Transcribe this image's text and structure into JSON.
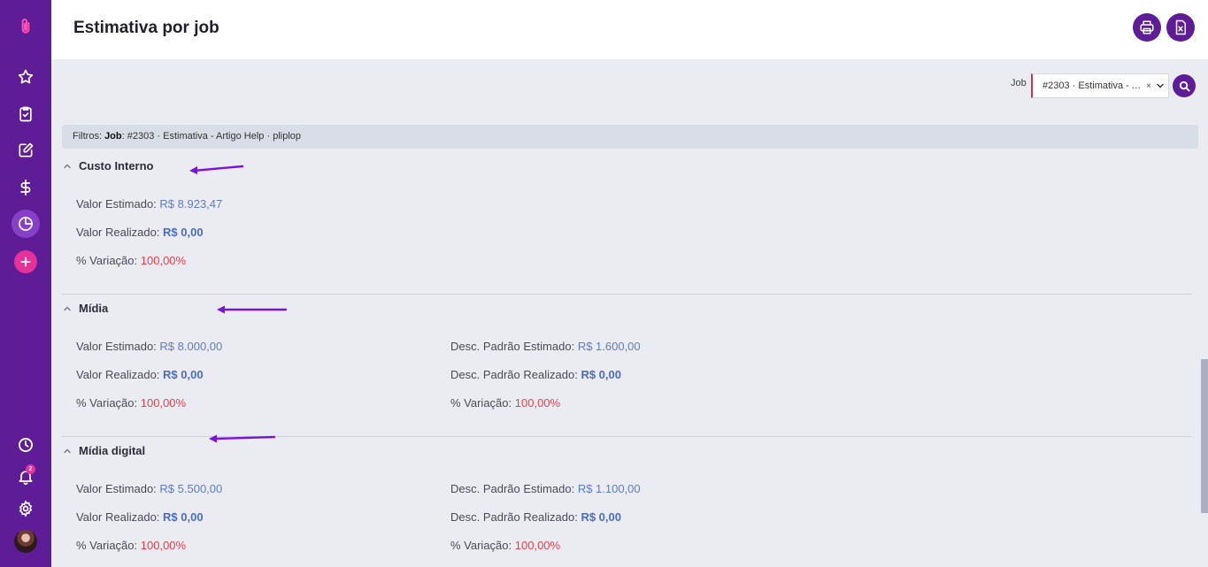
{
  "page_title": "Estimativa por job",
  "sidebar": {
    "icons": [
      "paperclip-logo-icon",
      "star-icon",
      "clipboard-check-icon",
      "edit-icon",
      "dollar-icon",
      "pie-chart-icon",
      "plus-icon",
      "clock-icon",
      "bell-icon",
      "gear-icon",
      "avatar"
    ],
    "notification_count": "2"
  },
  "filter": {
    "job_label": "Job",
    "job_value": "#2303 · Estimativa - Artigo Help · pliplop",
    "clear_symbol": "×"
  },
  "filters_bar": {
    "prefix": "Filtros:",
    "key": "Job",
    "value": ": #2303 · Estimativa - Artigo Help · pliplop"
  },
  "sections": [
    {
      "title": "Custo Interno",
      "left": [
        {
          "label": "Valor Estimado:",
          "value": "R$ 8.923,47"
        },
        {
          "label": "Valor Realizado:",
          "value": "R$ 0,00"
        },
        {
          "label": "% Variação:",
          "value": "100,00%"
        }
      ]
    },
    {
      "title": "Mídia",
      "left": [
        {
          "label": "Valor Estimado:",
          "value": "R$ 8.000,00"
        },
        {
          "label": "Valor Realizado:",
          "value": "R$ 0,00"
        },
        {
          "label": "% Variação:",
          "value": "100,00%"
        }
      ],
      "right": [
        {
          "label": "Desc. Padrão Estimado:",
          "value": "R$ 1.600,00"
        },
        {
          "label": "Desc. Padrão Realizado:",
          "value": "R$ 0,00"
        },
        {
          "label": "% Variação:",
          "value": "100,00%"
        }
      ]
    },
    {
      "title": "Mídia digital",
      "left": [
        {
          "label": "Valor Estimado:",
          "value": "R$ 5.500,00"
        },
        {
          "label": "Valor Realizado:",
          "value": "R$ 0,00"
        },
        {
          "label": "% Variação:",
          "value": "100,00%"
        }
      ],
      "right": [
        {
          "label": "Desc. Padrão Estimado:",
          "value": "R$ 1.100,00"
        },
        {
          "label": "Desc. Padrão Realizado:",
          "value": "R$ 0,00"
        },
        {
          "label": "% Variação:",
          "value": "100,00%"
        }
      ]
    }
  ],
  "colors": {
    "sidebar": "#5e1d96",
    "accent_pink": "#e4329a",
    "estimated_value": "#5d7cc4",
    "variation_value": "#e5404c",
    "annotation_arrow": "#7a12e0"
  }
}
